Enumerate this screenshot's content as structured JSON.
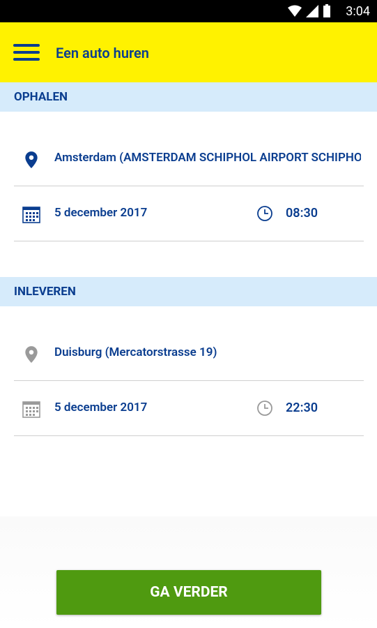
{
  "status": {
    "time": "3:04"
  },
  "appbar": {
    "title": "Een auto huren"
  },
  "pickup": {
    "header": "OPHALEN",
    "location": "Amsterdam (AMSTERDAM SCHIPHOL AIRPORT SCHIPHOL)",
    "date": "5 december 2017",
    "time": "08:30"
  },
  "dropoff": {
    "header": "INLEVEREN",
    "location": "Duisburg (Mercatorstrasse 19)",
    "date": "5 december 2017",
    "time": "22:30"
  },
  "continue_label": "GA VERDER",
  "colors": {
    "brand_yellow": "#FFF200",
    "brand_blue": "#0a3d8f",
    "button_green": "#4f9a10",
    "section_bg": "#d6ebfb"
  }
}
